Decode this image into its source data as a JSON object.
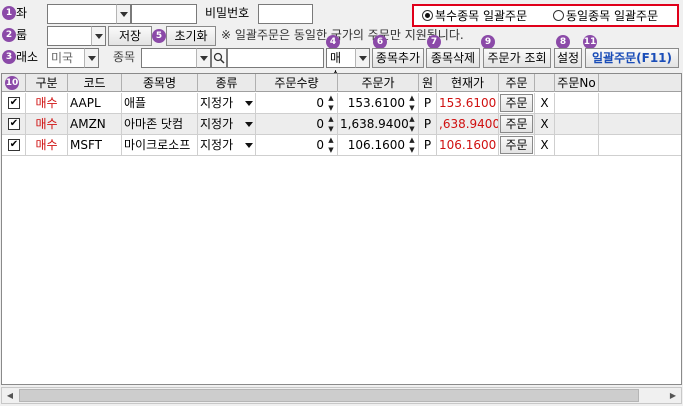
{
  "row1": {
    "account_label": "좌",
    "account_value": "",
    "account_name": "",
    "password_label": "비밀번호",
    "password_value": ""
  },
  "radio_group": {
    "options": [
      {
        "label": "복수종목 일괄주문",
        "selected": true
      },
      {
        "label": "동일종목 일괄주문",
        "selected": false
      }
    ]
  },
  "row2": {
    "group_label": "룹",
    "group_value": "",
    "save_label": "저장",
    "reset_label": "초기화",
    "notice": "※ 일괄주문은 동일한 국가의 주문만 지원됩니다."
  },
  "row3": {
    "exchange_label": "래소",
    "exchange_value": "미국",
    "symbol_label": "종목",
    "symbol_value": "",
    "search_value": "",
    "side_value": "매수",
    "add_label": "종목추가",
    "delete_label": "종목삭제",
    "price_query_label": "주문가 조회",
    "settings_label": "설정",
    "batch_order_label": "일괄주문(F11)"
  },
  "badges": [
    "1",
    "2",
    "3",
    "4",
    "5",
    "6",
    "7",
    "8",
    "9",
    "10",
    "11"
  ],
  "grid": {
    "headers": [
      "",
      "구분",
      "코드",
      "종목명",
      "종류",
      "주문수량",
      "주문가",
      "원",
      "현재가",
      "주문",
      "",
      "주문No"
    ],
    "rows": [
      {
        "checked": true,
        "side": "매수",
        "code": "AAPL",
        "name": "애플",
        "type": "지정가",
        "qty": "0",
        "price": "153.6100",
        "unit": "P",
        "current": "153.6100",
        "order": "주문",
        "cancel": "X",
        "order_no": ""
      },
      {
        "checked": true,
        "side": "매수",
        "code": "AMZN",
        "name": "아마존 닷컴",
        "type": "지정가",
        "qty": "0",
        "price": "1,638.9400",
        "unit": "P",
        "current": ",638.9400",
        "order": "주문",
        "cancel": "X",
        "order_no": ""
      },
      {
        "checked": true,
        "side": "매수",
        "code": "MSFT",
        "name": "마이크로소프",
        "type": "지정가",
        "qty": "0",
        "price": "106.1600",
        "unit": "P",
        "current": "106.1600",
        "order": "주문",
        "cancel": "X",
        "order_no": ""
      }
    ]
  },
  "colors": {
    "accent_red": "#e0001a",
    "badge_purple": "#8b4aa8",
    "buy_red": "#d01010",
    "link_blue": "#1a4db8"
  }
}
